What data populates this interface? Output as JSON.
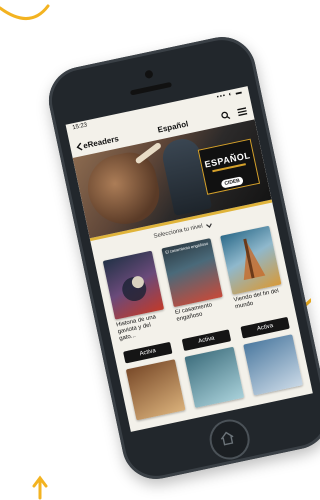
{
  "status_bar": {
    "time": "15:23",
    "indicators": "▪▪▪ ◐ ▬"
  },
  "nav": {
    "back_label": "eReaders",
    "title": "Español"
  },
  "hero": {
    "badge_title": "ESPAÑOL",
    "badge_publisher": "CIDEB"
  },
  "level_selector": {
    "label": "Selecciona tu nivel"
  },
  "books": [
    {
      "title": "Historia de una gaviota y del gato...",
      "action": "Activa",
      "cover_color": "#233247",
      "cover_title": ""
    },
    {
      "title": "El casamiento engañoso",
      "action": "Activa",
      "cover_color": "#2c3b44",
      "cover_title": "El casamiento engañoso"
    },
    {
      "title": "Viendo del fin del mundo",
      "action": "Activa",
      "cover_color": "#2d6b8a",
      "cover_title": ""
    }
  ],
  "more_books": [
    {
      "cover_color": "#7a4b2a"
    },
    {
      "cover_color": "#3f6f7e"
    },
    {
      "cover_color": "#4d7aa0"
    }
  ],
  "colors": {
    "accent": "#f3b321",
    "brand_gold": "#d5a12b"
  }
}
